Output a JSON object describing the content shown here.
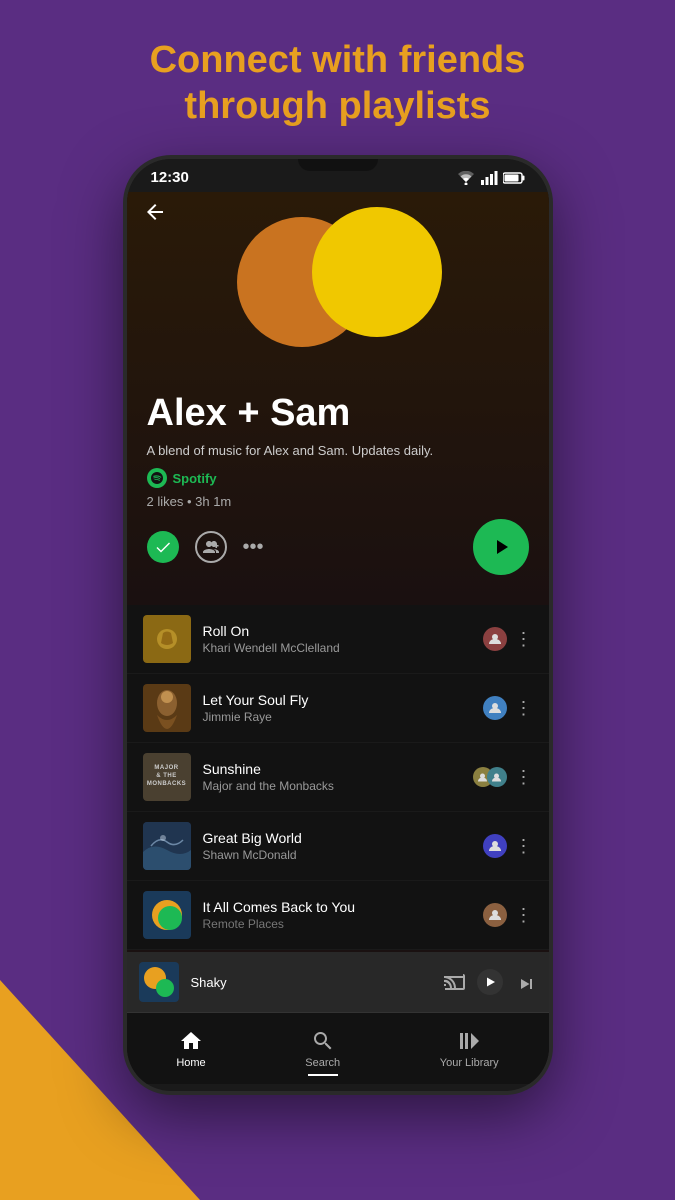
{
  "page": {
    "headline_line1": "Connect with friends",
    "headline_line2": "through playlists",
    "bg_color": "#5a2d82",
    "accent_color": "#e8a020"
  },
  "status_bar": {
    "time": "12:30",
    "wifi": true,
    "signal": true,
    "battery": true
  },
  "playlist": {
    "title": "Alex + Sam",
    "description": "A blend of music for Alex and Sam. Updates daily.",
    "creator": "Spotify",
    "likes": "2 likes",
    "duration": "3h 1m",
    "meta": "2 likes • 3h 1m"
  },
  "tracks": [
    {
      "name": "Roll On",
      "artist": "Khari Wendell McClelland",
      "has_avatar": true
    },
    {
      "name": "Let Your Soul Fly",
      "artist": "Jimmie Raye",
      "has_avatar": true
    },
    {
      "name": "Sunshine",
      "artist": "Major and the Monbacks",
      "has_avatar": true,
      "has_avatar2": true
    },
    {
      "name": "Great Big World",
      "artist": "Shawn McDonald",
      "has_avatar": true
    },
    {
      "name": "It All Comes Back to You",
      "artist": "Remote Places",
      "has_avatar": true
    }
  ],
  "now_playing": {
    "title": "Shaky"
  },
  "bottom_nav": {
    "home": "Home",
    "search": "Search",
    "library": "Your Library"
  }
}
